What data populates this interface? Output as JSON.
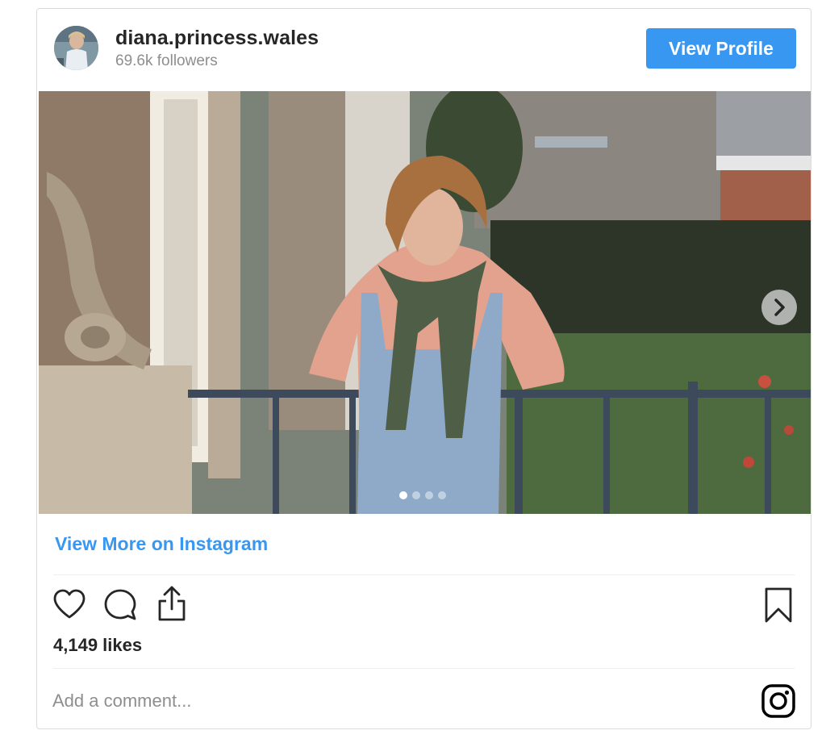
{
  "profile": {
    "username": "diana.princess.wales",
    "followers": "69.6k followers",
    "view_profile_label": "View Profile"
  },
  "carousel": {
    "slide_count": 4,
    "active_index": 0
  },
  "post": {
    "more_link_label": "View More on Instagram",
    "likes": "4,149 likes",
    "comment_placeholder": "Add a comment..."
  },
  "icons": {
    "like": "heart-icon",
    "comment": "comment-icon",
    "share": "share-icon",
    "save": "bookmark-icon",
    "brand": "instagram-icon",
    "next": "chevron-right-icon"
  },
  "colors": {
    "accent": "#3897f0",
    "text": "#262626",
    "muted": "#8e8e8e",
    "border": "#dbdbdb"
  }
}
